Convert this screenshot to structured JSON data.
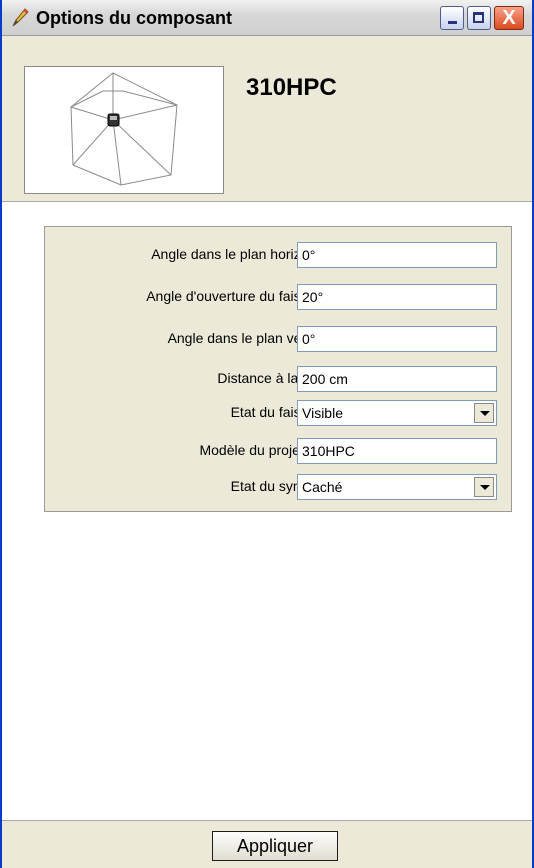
{
  "window": {
    "title": "Options du composant",
    "title_icon": "pencil-icon",
    "controls": {
      "minimize_icon": "minimize-icon",
      "maximize_icon": "maximize-icon",
      "close_icon": "close-icon",
      "close_glyph": "X"
    }
  },
  "header": {
    "component_name": "310HPC",
    "preview_icon": "projector-beam-diagram"
  },
  "properties": [
    {
      "label": "Angle dans le plan horizontal",
      "value": "0°",
      "type": "text"
    },
    {
      "label": "Angle d'ouverture du faisceau",
      "value": "20°",
      "type": "text"
    },
    {
      "label": "Angle dans le plan vertical",
      "value": "0°",
      "type": "text"
    },
    {
      "label": "Distance à la cible",
      "value": "200 cm",
      "type": "text"
    },
    {
      "label": "Etat du faisceau",
      "value": "Visible",
      "type": "select"
    },
    {
      "label": "Modèle du projecteur",
      "value": "310HPC",
      "type": "text"
    },
    {
      "label": "Etat du symbole",
      "value": "Caché",
      "type": "select"
    }
  ],
  "footer": {
    "apply_label": "Appliquer"
  },
  "colors": {
    "window_border": "#0a3ac8",
    "dialog_bg": "#ece9d8",
    "close_button": "#dd4a20",
    "field_border": "#7f9db9"
  }
}
